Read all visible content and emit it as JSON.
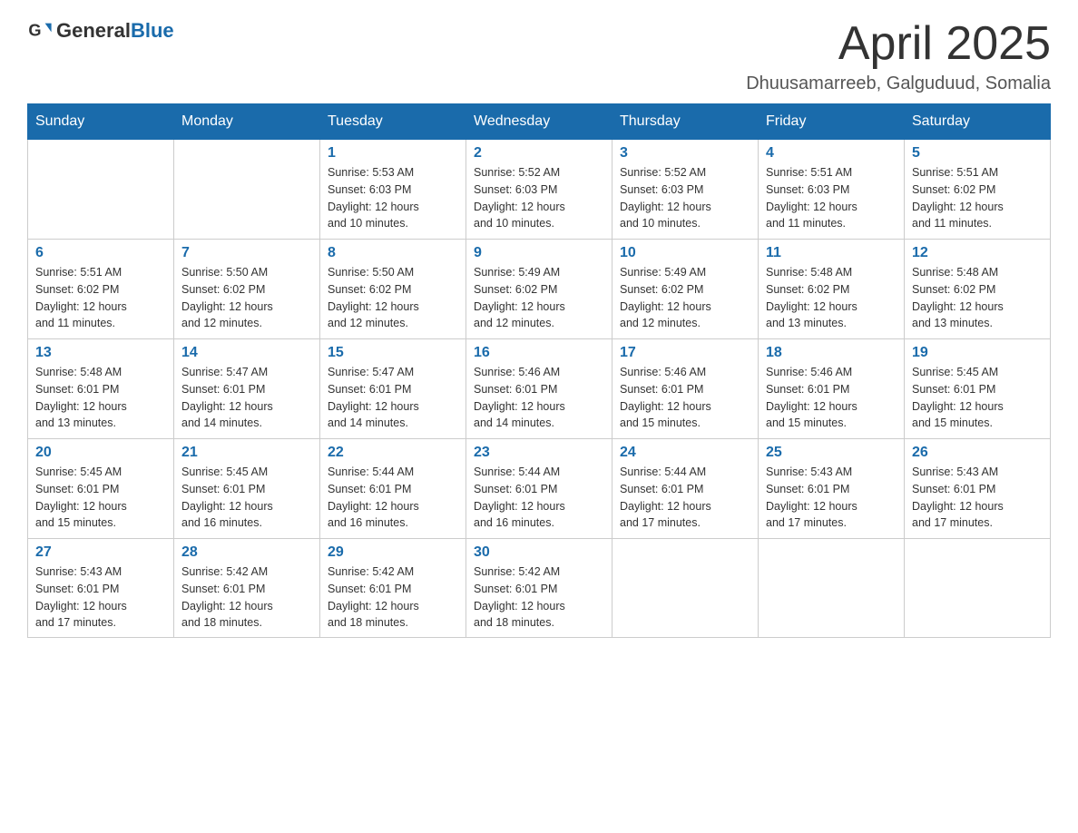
{
  "header": {
    "logo_general": "General",
    "logo_blue": "Blue",
    "month_title": "April 2025",
    "subtitle": "Dhuusamarreeb, Galguduud, Somalia"
  },
  "weekdays": [
    "Sunday",
    "Monday",
    "Tuesday",
    "Wednesday",
    "Thursday",
    "Friday",
    "Saturday"
  ],
  "weeks": [
    [
      {
        "day": "",
        "info": ""
      },
      {
        "day": "",
        "info": ""
      },
      {
        "day": "1",
        "info": "Sunrise: 5:53 AM\nSunset: 6:03 PM\nDaylight: 12 hours\nand 10 minutes."
      },
      {
        "day": "2",
        "info": "Sunrise: 5:52 AM\nSunset: 6:03 PM\nDaylight: 12 hours\nand 10 minutes."
      },
      {
        "day": "3",
        "info": "Sunrise: 5:52 AM\nSunset: 6:03 PM\nDaylight: 12 hours\nand 10 minutes."
      },
      {
        "day": "4",
        "info": "Sunrise: 5:51 AM\nSunset: 6:03 PM\nDaylight: 12 hours\nand 11 minutes."
      },
      {
        "day": "5",
        "info": "Sunrise: 5:51 AM\nSunset: 6:02 PM\nDaylight: 12 hours\nand 11 minutes."
      }
    ],
    [
      {
        "day": "6",
        "info": "Sunrise: 5:51 AM\nSunset: 6:02 PM\nDaylight: 12 hours\nand 11 minutes."
      },
      {
        "day": "7",
        "info": "Sunrise: 5:50 AM\nSunset: 6:02 PM\nDaylight: 12 hours\nand 12 minutes."
      },
      {
        "day": "8",
        "info": "Sunrise: 5:50 AM\nSunset: 6:02 PM\nDaylight: 12 hours\nand 12 minutes."
      },
      {
        "day": "9",
        "info": "Sunrise: 5:49 AM\nSunset: 6:02 PM\nDaylight: 12 hours\nand 12 minutes."
      },
      {
        "day": "10",
        "info": "Sunrise: 5:49 AM\nSunset: 6:02 PM\nDaylight: 12 hours\nand 12 minutes."
      },
      {
        "day": "11",
        "info": "Sunrise: 5:48 AM\nSunset: 6:02 PM\nDaylight: 12 hours\nand 13 minutes."
      },
      {
        "day": "12",
        "info": "Sunrise: 5:48 AM\nSunset: 6:02 PM\nDaylight: 12 hours\nand 13 minutes."
      }
    ],
    [
      {
        "day": "13",
        "info": "Sunrise: 5:48 AM\nSunset: 6:01 PM\nDaylight: 12 hours\nand 13 minutes."
      },
      {
        "day": "14",
        "info": "Sunrise: 5:47 AM\nSunset: 6:01 PM\nDaylight: 12 hours\nand 14 minutes."
      },
      {
        "day": "15",
        "info": "Sunrise: 5:47 AM\nSunset: 6:01 PM\nDaylight: 12 hours\nand 14 minutes."
      },
      {
        "day": "16",
        "info": "Sunrise: 5:46 AM\nSunset: 6:01 PM\nDaylight: 12 hours\nand 14 minutes."
      },
      {
        "day": "17",
        "info": "Sunrise: 5:46 AM\nSunset: 6:01 PM\nDaylight: 12 hours\nand 15 minutes."
      },
      {
        "day": "18",
        "info": "Sunrise: 5:46 AM\nSunset: 6:01 PM\nDaylight: 12 hours\nand 15 minutes."
      },
      {
        "day": "19",
        "info": "Sunrise: 5:45 AM\nSunset: 6:01 PM\nDaylight: 12 hours\nand 15 minutes."
      }
    ],
    [
      {
        "day": "20",
        "info": "Sunrise: 5:45 AM\nSunset: 6:01 PM\nDaylight: 12 hours\nand 15 minutes."
      },
      {
        "day": "21",
        "info": "Sunrise: 5:45 AM\nSunset: 6:01 PM\nDaylight: 12 hours\nand 16 minutes."
      },
      {
        "day": "22",
        "info": "Sunrise: 5:44 AM\nSunset: 6:01 PM\nDaylight: 12 hours\nand 16 minutes."
      },
      {
        "day": "23",
        "info": "Sunrise: 5:44 AM\nSunset: 6:01 PM\nDaylight: 12 hours\nand 16 minutes."
      },
      {
        "day": "24",
        "info": "Sunrise: 5:44 AM\nSunset: 6:01 PM\nDaylight: 12 hours\nand 17 minutes."
      },
      {
        "day": "25",
        "info": "Sunrise: 5:43 AM\nSunset: 6:01 PM\nDaylight: 12 hours\nand 17 minutes."
      },
      {
        "day": "26",
        "info": "Sunrise: 5:43 AM\nSunset: 6:01 PM\nDaylight: 12 hours\nand 17 minutes."
      }
    ],
    [
      {
        "day": "27",
        "info": "Sunrise: 5:43 AM\nSunset: 6:01 PM\nDaylight: 12 hours\nand 17 minutes."
      },
      {
        "day": "28",
        "info": "Sunrise: 5:42 AM\nSunset: 6:01 PM\nDaylight: 12 hours\nand 18 minutes."
      },
      {
        "day": "29",
        "info": "Sunrise: 5:42 AM\nSunset: 6:01 PM\nDaylight: 12 hours\nand 18 minutes."
      },
      {
        "day": "30",
        "info": "Sunrise: 5:42 AM\nSunset: 6:01 PM\nDaylight: 12 hours\nand 18 minutes."
      },
      {
        "day": "",
        "info": ""
      },
      {
        "day": "",
        "info": ""
      },
      {
        "day": "",
        "info": ""
      }
    ]
  ]
}
